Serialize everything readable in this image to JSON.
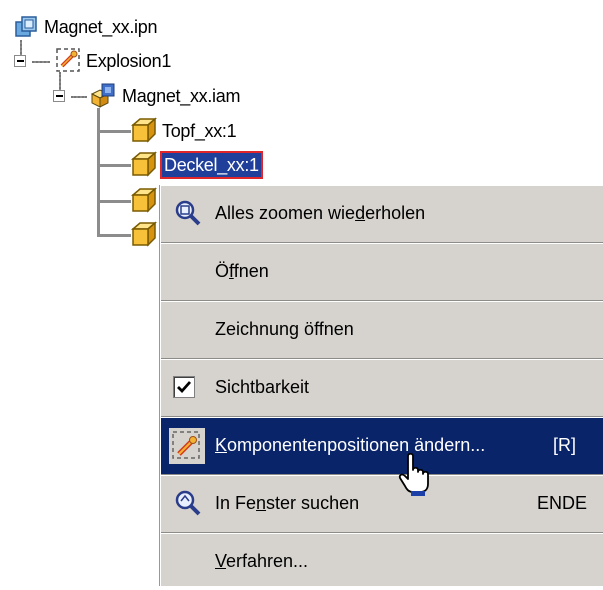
{
  "tree": {
    "root": {
      "label": "Magnet_xx.ipn",
      "icon": "presentation-file-icon"
    },
    "explosion": {
      "label": "Explosion1",
      "icon": "explosion-view-icon"
    },
    "assembly": {
      "label": "Magnet_xx.iam",
      "icon": "assembly-icon"
    },
    "parts": [
      {
        "label": "Topf_xx:1",
        "icon": "part-icon",
        "selected": false
      },
      {
        "label": "Deckel_xx:1",
        "icon": "part-icon",
        "selected": true
      },
      {
        "label": "",
        "icon": "part-icon",
        "selected": false
      },
      {
        "label": "",
        "icon": "part-icon",
        "selected": false
      }
    ]
  },
  "context_menu": {
    "items": [
      {
        "id": "zoom-all-repeat",
        "pre": "Alles zoomen wie",
        "ul": "d",
        "post": "erholen",
        "icon": "zoom-icon"
      },
      {
        "id": "open",
        "pre": "Ö",
        "ul": "f",
        "post": "fnen",
        "icon": ""
      },
      {
        "id": "open-drawing",
        "pre": "Zeichnung öffnen",
        "ul": "",
        "post": "",
        "icon": ""
      },
      {
        "id": "visibility",
        "pre": "Sichtbarkeit",
        "ul": "",
        "post": "",
        "icon": "checkbox-checked-icon",
        "checked": true
      },
      {
        "id": "change-component-positions",
        "pre": "",
        "ul": "K",
        "post": "omponentenpositionen ändern...",
        "shortcut": "[R]",
        "icon": "tweak-components-icon",
        "highlighted": true
      },
      {
        "id": "find-in-window",
        "pre": "In Fe",
        "ul": "n",
        "post": "ster suchen",
        "shortcut": "ENDE",
        "icon": "find-in-window-icon"
      },
      {
        "id": "procedure",
        "pre": "",
        "ul": "V",
        "post": "erfahren...",
        "icon": ""
      }
    ]
  },
  "cursor": {
    "icon": "hand-pointer-cursor-icon"
  },
  "colors": {
    "selection_bg": "#1f3f9a",
    "selection_border": "#e0262a",
    "menu_bg": "#d6d3ce",
    "menu_highlight": "#0a246a",
    "part_icon_fill": "#f7c23a"
  }
}
